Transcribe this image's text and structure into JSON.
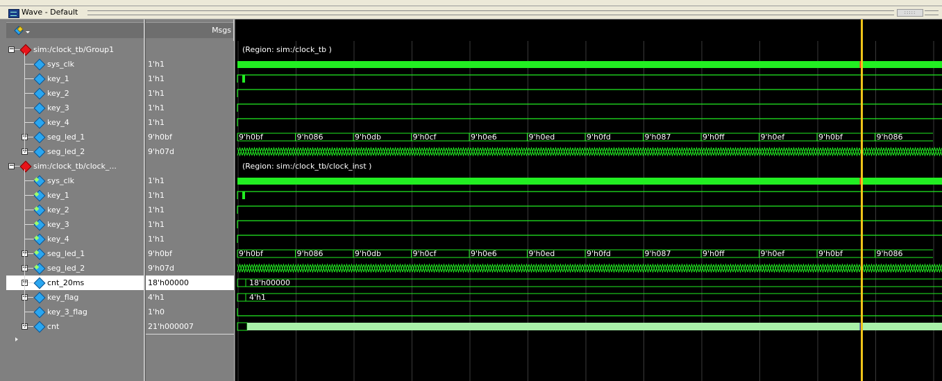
{
  "window": {
    "title": "Wave - Default"
  },
  "header": {
    "msgs_label": "Msgs",
    "cursor_tool_icon": "wave-tool-icon"
  },
  "signals": [
    {
      "name": "sim:/clock_tb/Group1",
      "value": "",
      "kind": "group",
      "indent": 0
    },
    {
      "name": "sys_clk",
      "value": "1'h1",
      "kind": "signal",
      "indent": 1
    },
    {
      "name": "key_1",
      "value": "1'h1",
      "kind": "signal",
      "indent": 1
    },
    {
      "name": "key_2",
      "value": "1'h1",
      "kind": "signal",
      "indent": 1
    },
    {
      "name": "key_3",
      "value": "1'h1",
      "kind": "signal",
      "indent": 1
    },
    {
      "name": "key_4",
      "value": "1'h1",
      "kind": "signal",
      "indent": 1
    },
    {
      "name": "seg_led_1",
      "value": "9'h0bf",
      "kind": "bus",
      "indent": 1
    },
    {
      "name": "seg_led_2",
      "value": "9'h07d",
      "kind": "bus",
      "indent": 1
    },
    {
      "name": "sim:/clock_tb/clock_...",
      "value": "",
      "kind": "group",
      "indent": 0
    },
    {
      "name": "sys_clk",
      "value": "1'h1",
      "kind": "input",
      "indent": 1
    },
    {
      "name": "key_1",
      "value": "1'h1",
      "kind": "input",
      "indent": 1
    },
    {
      "name": "key_2",
      "value": "1'h1",
      "kind": "input",
      "indent": 1
    },
    {
      "name": "key_3",
      "value": "1'h1",
      "kind": "input",
      "indent": 1
    },
    {
      "name": "key_4",
      "value": "1'h1",
      "kind": "input",
      "indent": 1
    },
    {
      "name": "seg_led_1",
      "value": "9'h0bf",
      "kind": "bus-out",
      "indent": 1
    },
    {
      "name": "seg_led_2",
      "value": "9'h07d",
      "kind": "bus-out",
      "indent": 1
    },
    {
      "name": "cnt_20ms",
      "value": "18'h00000",
      "kind": "bus",
      "indent": 1,
      "selected": true
    },
    {
      "name": "key_flag",
      "value": "4'h1",
      "kind": "bus",
      "indent": 1
    },
    {
      "name": "key_3_flag",
      "value": "1'h0",
      "kind": "signal",
      "indent": 1
    },
    {
      "name": "cnt",
      "value": "21'h000007",
      "kind": "bus",
      "indent": 1
    }
  ],
  "regions": {
    "group1": "(Region: sim:/clock_tb )",
    "clock_inst": "(Region: sim:/clock_tb/clock_inst )"
  },
  "seg_led_1_values": [
    "9'h0bf",
    "9'h086",
    "9'h0db",
    "9'h0cf",
    "9'h0e6",
    "9'h0ed",
    "9'h0fd",
    "9'h087",
    "9'h0ff",
    "9'h0ef",
    "9'h0bf",
    "9'h086"
  ],
  "cnt_20ms_label": "18'h00000",
  "key_flag_label": "4'h1",
  "colors": {
    "wave": "#22ee22",
    "bus": "#22ee22",
    "cnt_fill": "#a8f0a8",
    "cursor": "#f0c419",
    "grid": "#3a3a3a"
  }
}
